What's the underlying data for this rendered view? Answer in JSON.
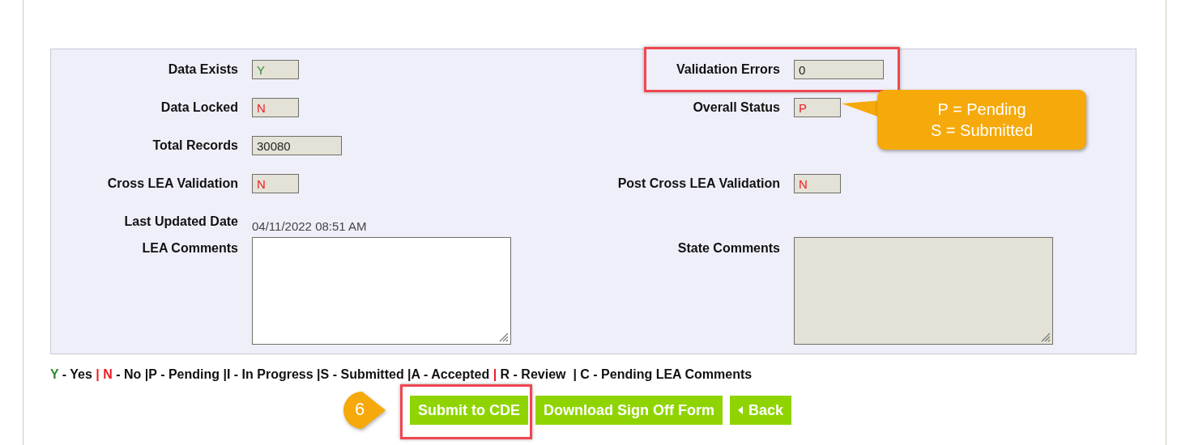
{
  "rows": [
    {
      "left": {
        "label": "Data Exists",
        "kind": "flag",
        "value": "Y",
        "color": "#2e8b2e",
        "highlighted": false
      },
      "right": {
        "label": "Validation Errors",
        "kind": "count",
        "value": "0",
        "color": "#222222",
        "highlighted": true
      }
    },
    {
      "left": {
        "label": "Data Locked",
        "kind": "flag",
        "value": "N",
        "color": "#ee1c25",
        "highlighted": false
      },
      "right": {
        "label": "Overall Status",
        "kind": "flag",
        "value": "P",
        "color": "#ee1c25",
        "highlighted": false
      }
    },
    {
      "left": {
        "label": "Total Records",
        "kind": "count",
        "value": "30080",
        "color": "#222222",
        "highlighted": false
      }
    },
    {
      "left": {
        "label": "Cross LEA Validation",
        "kind": "flag",
        "value": "N",
        "color": "#ee1c25",
        "highlighted": false
      },
      "right": {
        "label": "Post Cross LEA Validation",
        "kind": "flag",
        "value": "N",
        "color": "#ee1c25",
        "highlighted": false
      }
    },
    {
      "left": {
        "label": "Last Updated Date",
        "kind": "text",
        "value": "04/11/2022 08:51 AM",
        "color": "#444444",
        "highlighted": false
      }
    }
  ],
  "comments": [
    {
      "label": "LEA Comments",
      "disabled": false
    },
    {
      "label": "State Comments",
      "disabled": true
    }
  ],
  "tooltip": {
    "lines": [
      "P = Pending",
      "S = Submitted"
    ]
  },
  "legend": [
    {
      "text": "Y",
      "color": "#2e8b2e"
    },
    {
      "text": " - Yes ",
      "color": "#111111"
    },
    {
      "text": "| N",
      "color": "#ee1c25"
    },
    {
      "text": " - No |P - Pending |I - In Progress |S - Submitted |A - Accepted ",
      "color": "#111111"
    },
    {
      "text": "|",
      "color": "#ee1c25"
    },
    {
      "text": " R - Review  | C - Pending LEA Comments",
      "color": "#111111"
    }
  ],
  "step_badge": "6",
  "buttons": [
    {
      "label": "Submit to CDE",
      "kind": "plain",
      "highlighted": true
    },
    {
      "label": "Download Sign Off Form",
      "kind": "plain",
      "highlighted": false
    },
    {
      "label": "Back",
      "kind": "back",
      "highlighted": false
    }
  ]
}
